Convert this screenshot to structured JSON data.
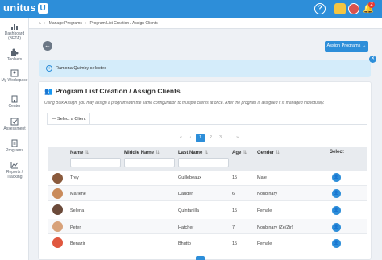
{
  "app": {
    "name": "unitus",
    "logo_mark": "U"
  },
  "topbar": {
    "help_label": "?",
    "notification_count": "2",
    "bell": "🔔"
  },
  "sidebar": {
    "items": [
      {
        "label": "Dashboard (BETA)",
        "icon": "chart-icon"
      },
      {
        "label": "Toolsets",
        "icon": "puzzle-icon"
      },
      {
        "label": "My Workspace",
        "icon": "person-icon"
      },
      {
        "label": "Center",
        "icon": "building-icon"
      },
      {
        "label": "Assessment",
        "icon": "checkbox-icon"
      },
      {
        "label": "Programs",
        "icon": "document-icon"
      },
      {
        "label": "Reports / Tracking",
        "icon": "line-chart-icon"
      }
    ]
  },
  "breadcrumb": {
    "home": "⌂",
    "items": [
      "Manage Programs",
      "Program List Creation / Assign Clients"
    ]
  },
  "back_label": "←",
  "assign_button": "Assign Programs →",
  "alert": {
    "icon": "i",
    "message": "Ramona Quimby selected",
    "close": "✕"
  },
  "card": {
    "title_icon": "👥",
    "title": "Program List Creation / Assign Clients",
    "description": "Using Bulk Assign, you may assign a program with the same configuration to multiple clients at once. After the program is assigned it is managed individually.",
    "tab_label": "— Select a Client"
  },
  "pager": {
    "first": "«",
    "prev": "‹",
    "pages": [
      "1",
      "2",
      "3"
    ],
    "next": "›",
    "last": "»"
  },
  "table": {
    "headers": {
      "name": "Name",
      "middle": "Middle Name",
      "last": "Last Name",
      "age": "Age",
      "gender": "Gender",
      "select": "Select"
    },
    "sort_glyph": "⇅",
    "select_glyph": "👤",
    "rows": [
      {
        "name": "Trey",
        "middle": "",
        "last": "Guillebeaux",
        "age": "15",
        "gender": "Male",
        "avatar_color": "#8a5a3c"
      },
      {
        "name": "Marlene",
        "middle": "",
        "last": "Dauden",
        "age": "6",
        "gender": "Nonbinary",
        "avatar_color": "#c98a5a"
      },
      {
        "name": "Selena",
        "middle": "",
        "last": "Quintanilla",
        "age": "15",
        "gender": "Female",
        "avatar_color": "#6b4a3a"
      },
      {
        "name": "Peter",
        "middle": "",
        "last": "Hatcher",
        "age": "7",
        "gender": "Nonbinary (Ze/Zir)",
        "avatar_color": "#d8a27a"
      },
      {
        "name": "Benazir",
        "middle": "",
        "last": "Bhutto",
        "age": "15",
        "gender": "Female",
        "avatar_color": "#e0573f"
      }
    ]
  },
  "colors": {
    "primary": "#2d8ed9",
    "alert_bg": "#d4ecfa",
    "sidebar_bg": "#ffffff"
  }
}
